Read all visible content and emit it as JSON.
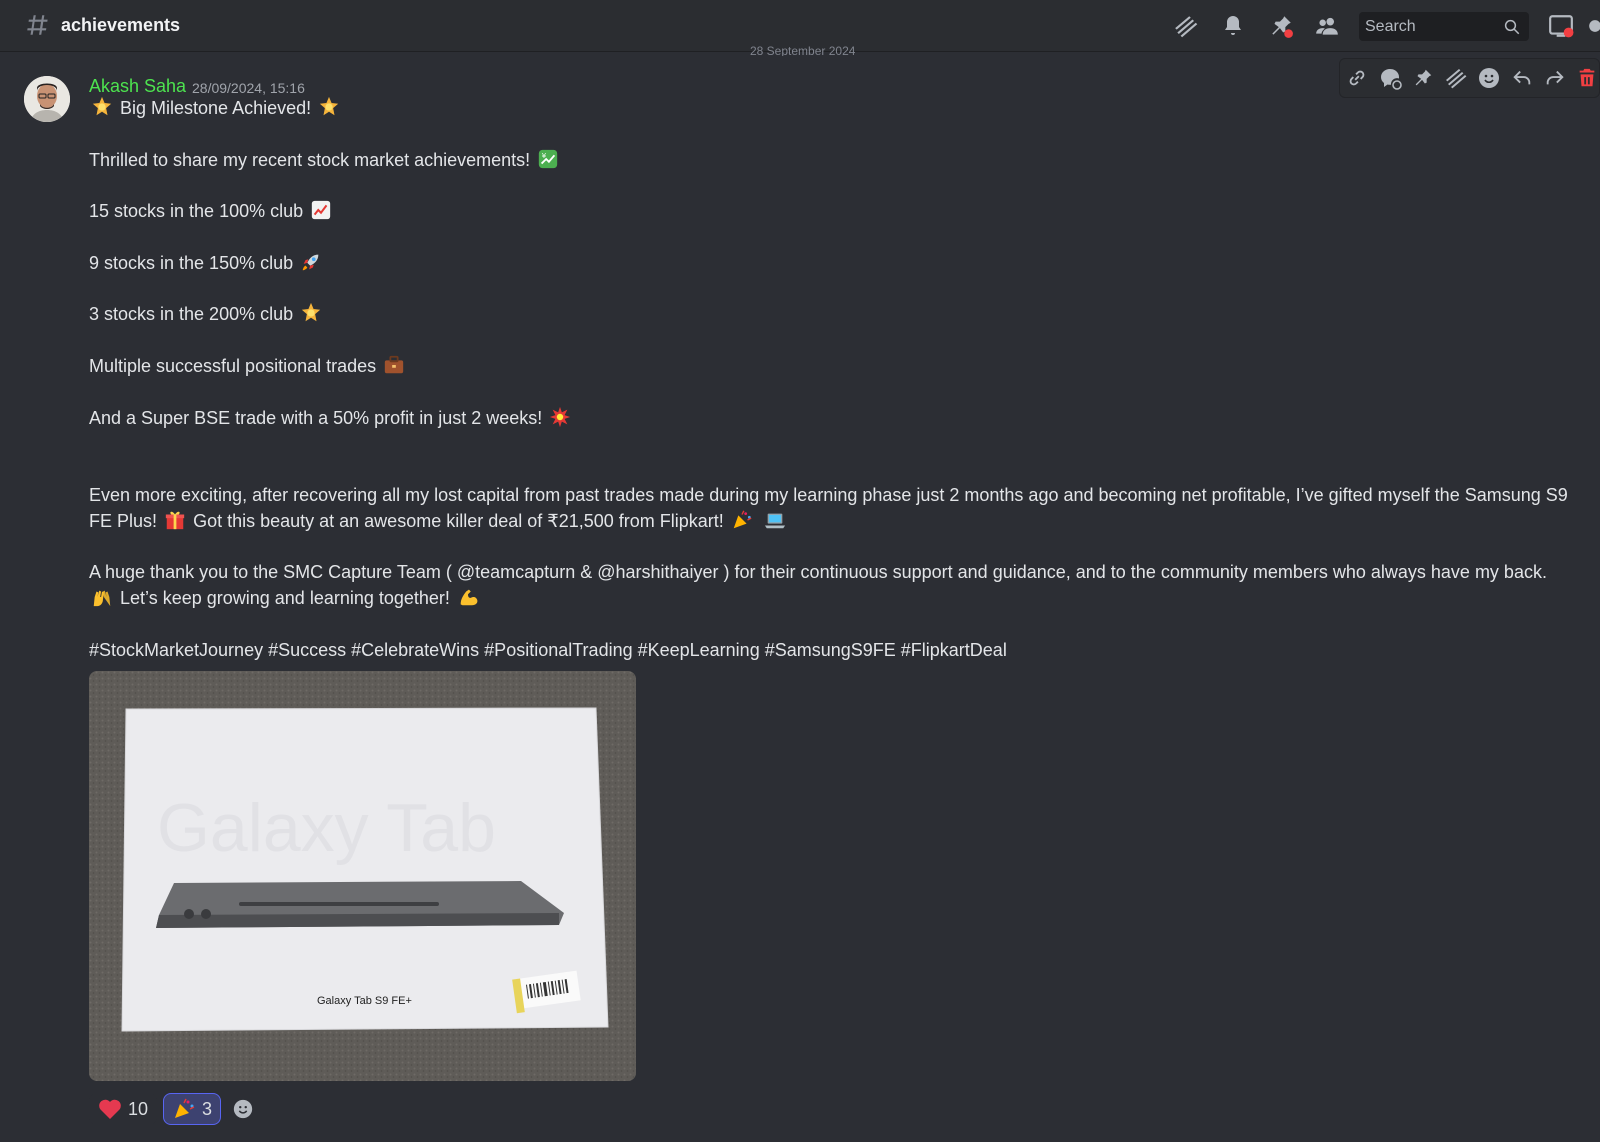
{
  "header": {
    "channel_name": "achievements",
    "search_placeholder": "Search"
  },
  "date_divider": "28 September 2024",
  "message": {
    "author": "Akash Saha",
    "timestamp": "28/09/2024, 15:16",
    "lines": [
      "Big Milestone Achieved!",
      "Thrilled to share my recent stock market achievements!",
      "15 stocks in the 100% club",
      "9 stocks in the 150% club",
      "3 stocks in the 200% club",
      "Multiple successful positional trades",
      "And a Super BSE trade with a 50% profit in just 2 weeks!",
      "Even more exciting, after recovering all my lost capital from past trades made during my learning phase just 2 months ago and becoming net profitable, I’ve gifted myself the Samsung S9 FE Plus!",
      "Got this beauty at an awesome killer deal of ₹21,500 from Flipkart!",
      "A huge thank you to the SMC Capture Team ( @teamcapturn & @harshithaiyer )  for their continuous support and guidance, and to the community members who always have my back.",
      "Let’s keep growing and learning together!",
      "#StockMarketJourney #Success #CelebrateWins #PositionalTrading #KeepLearning #SamsungS9FE #FlipkartDeal"
    ],
    "attachment": {
      "box_brand_text": "Galaxy Tab",
      "box_model_text": "Galaxy Tab S9 FE+"
    },
    "reactions": [
      {
        "emoji": "heart",
        "count": "10",
        "active": false
      },
      {
        "emoji": "party-popper",
        "count": "3",
        "active": true
      }
    ]
  },
  "colors": {
    "background": "#2c2e34",
    "author": "#4de34f",
    "accent": "#5865f2",
    "danger": "#f23f42"
  }
}
